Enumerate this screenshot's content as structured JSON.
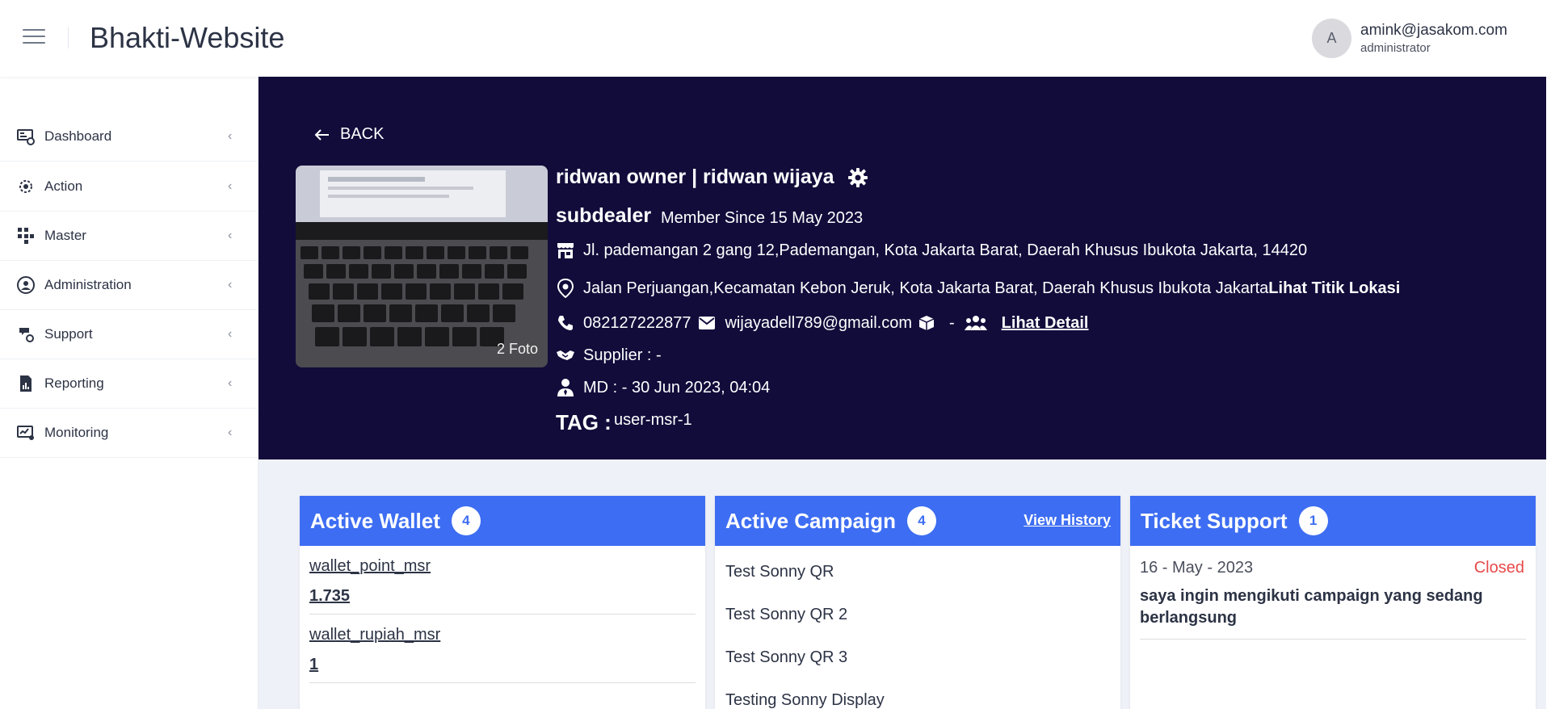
{
  "header": {
    "app_title": "Bhakti-Website",
    "avatar_initial": "A",
    "user_email": "amink@jasakom.com",
    "user_role": "administrator"
  },
  "sidebar": {
    "items": [
      {
        "label": "Dashboard",
        "icon": "dashboard-icon"
      },
      {
        "label": "Action",
        "icon": "action-icon"
      },
      {
        "label": "Master",
        "icon": "master-icon"
      },
      {
        "label": "Administration",
        "icon": "administration-icon"
      },
      {
        "label": "Support",
        "icon": "support-icon"
      },
      {
        "label": "Reporting",
        "icon": "reporting-icon"
      },
      {
        "label": "Monitoring",
        "icon": "monitoring-icon"
      }
    ]
  },
  "profile": {
    "back_label": "BACK",
    "photo_count": "2 Foto",
    "name": "ridwan owner | ridwan wijaya",
    "role": "subdealer",
    "member_since": "Member Since 15 May 2023",
    "store_address": "Jl. pademangan 2 gang 12,Pademangan, Kota Jakarta Barat, Daerah Khusus Ibukota Jakarta, 14420",
    "location_address": "Jalan Perjuangan,Kecamatan Kebon Jeruk, Kota Jakarta Barat, Daerah Khusus Ibukota Jakarta",
    "location_link": "Lihat Titik Lokasi",
    "phone": "082127222877",
    "email": "wijayadell789@gmail.com",
    "box_value": "-",
    "detail_link": "Lihat Detail",
    "supplier": "Supplier : -",
    "md": "MD : - 30 Jun 2023, 04:04",
    "tag_label": "TAG :",
    "tag_value": "user-msr-1"
  },
  "cards": {
    "wallet": {
      "title": "Active Wallet",
      "count": "4",
      "items": [
        {
          "name": "wallet_point_msr",
          "value": "1.735"
        },
        {
          "name": "wallet_rupiah_msr",
          "value": "1"
        }
      ]
    },
    "campaign": {
      "title": "Active Campaign",
      "count": "4",
      "view_history": "View History",
      "items": [
        "Test Sonny QR",
        "Test Sonny QR 2",
        "Test Sonny QR 3",
        "Testing Sonny Display"
      ]
    },
    "ticket": {
      "title": "Ticket Support",
      "count": "1",
      "items": [
        {
          "date": "16 - May - 2023",
          "status": "Closed",
          "text": "saya ingin mengikuti campaign yang sedang berlangsung"
        }
      ]
    }
  },
  "colors": {
    "hero_bg": "#120c3b",
    "card_header": "#3d6df2",
    "status_closed": "#e84a4a"
  }
}
